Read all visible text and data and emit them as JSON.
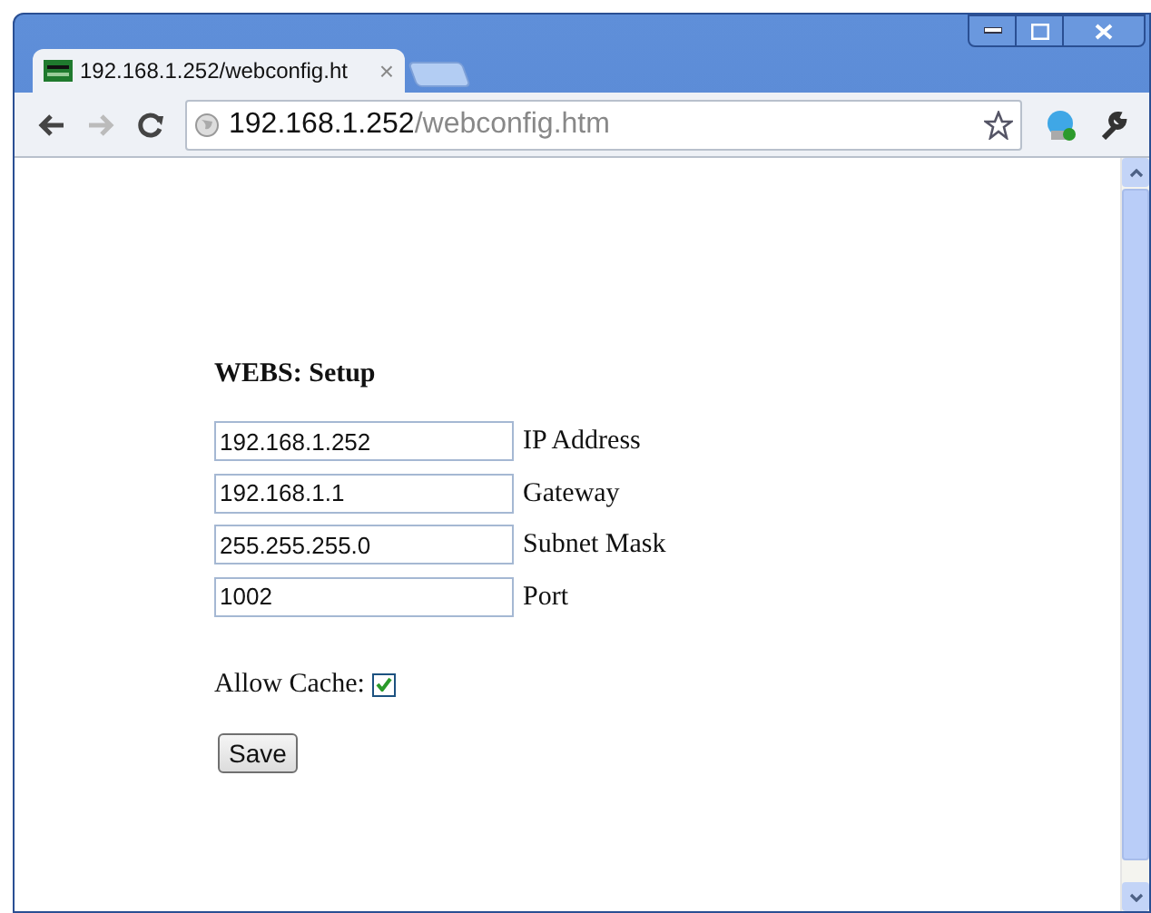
{
  "tabs": [
    {
      "title": "192.168.1.252/webconfig.ht",
      "close": "×",
      "selected": true
    }
  ],
  "address_bar": {
    "host": "192.168.1.252",
    "path": "/webconfig.htm"
  },
  "page": {
    "heading": "WEBS: Setup",
    "fields": [
      {
        "value": "192.168.1.252",
        "label": "IP Address"
      },
      {
        "value": "192.168.1.1",
        "label": "Gateway"
      },
      {
        "value": "255.255.255.0",
        "label": "Subnet Mask"
      },
      {
        "value": "1002",
        "label": "Port"
      }
    ],
    "allow_cache": {
      "label": "Allow Cache:",
      "checked": true
    },
    "save_button": "Save"
  }
}
